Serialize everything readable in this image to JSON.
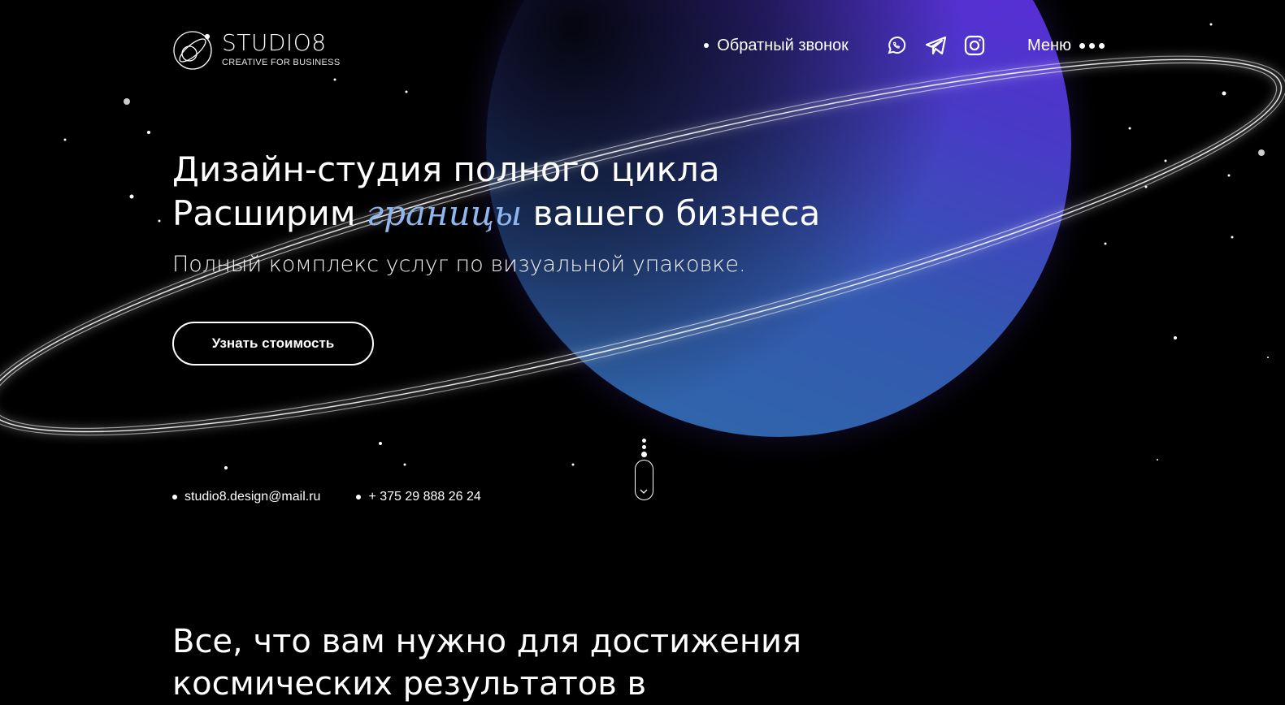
{
  "brand": {
    "name": "STUDIO8",
    "tagline": "CREATIVE FOR BUSINESS",
    "logo_icon": "orbit-logo-icon"
  },
  "nav": {
    "callback_label": "Обратный звонок",
    "social": [
      {
        "icon": "whatsapp-icon"
      },
      {
        "icon": "telegram-icon"
      },
      {
        "icon": "instagram-icon"
      }
    ],
    "menu_label": "Меню"
  },
  "hero": {
    "title_line1": "Дизайн-студия полного цикла",
    "title_line2_before": "Расширим",
    "title_line2_accent": "границы",
    "title_line2_after": "вашего бизнеса",
    "subtitle": "Полный комплекс услуг по визуальной упаковке.",
    "cta_label": "Узнать стоимость"
  },
  "contacts": {
    "email": "studio8.design@mail.ru",
    "phone": "+ 375 29 888 26 24"
  },
  "scroll_hint_icon": "scroll-down-icon",
  "section": {
    "title_line1": "Все, что вам нужно для достижения",
    "title_line2": "космических результатов в"
  },
  "colors": {
    "background": "#000000",
    "accent_text": "#8fb6ee",
    "planet_top": "#6a22e6",
    "planet_bottom": "#2f6aa8"
  }
}
